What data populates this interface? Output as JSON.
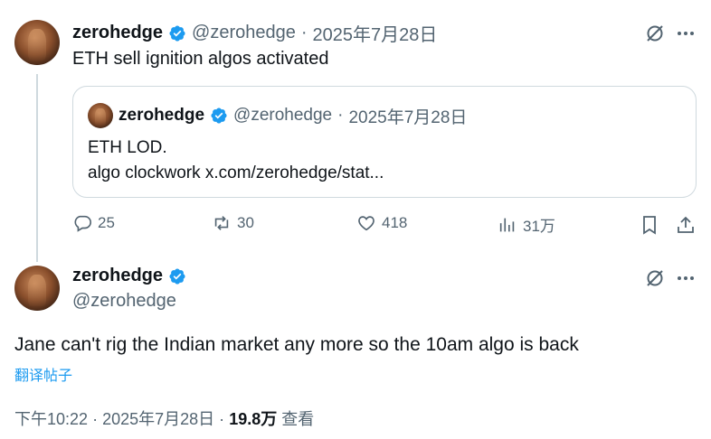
{
  "parent": {
    "display_name": "zerohedge",
    "handle": "@zerohedge",
    "separator": "·",
    "date": "2025年7月28日",
    "text": "ETH sell ignition algos activated",
    "quote": {
      "display_name": "zerohedge",
      "handle": "@zerohedge",
      "separator": "·",
      "date": "2025年7月28日",
      "line1": "ETH LOD.",
      "line2": "algo clockwork x.com/zerohedge/stat..."
    },
    "actions": {
      "replies": "25",
      "reposts": "30",
      "likes": "418",
      "views": "31万"
    }
  },
  "main": {
    "display_name": "zerohedge",
    "handle": "@zerohedge",
    "text": "Jane can't rig the Indian market any more so the 10am algo is back",
    "translate_label": "翻译帖子",
    "time": "下午10:22",
    "separator": "·",
    "date": "2025年7月28日",
    "separator2": "·",
    "views_count": "19.8万",
    "views_label": "查看"
  },
  "colors": {
    "verified": "#1d9bf0",
    "link": "#1d9bf0",
    "secondary_text": "#536471",
    "border": "#cfd9de"
  },
  "icons": [
    "verified-badge-icon",
    "grok-icon",
    "more-icon",
    "reply-icon",
    "repost-icon",
    "like-icon",
    "views-icon",
    "bookmark-icon",
    "share-icon"
  ]
}
